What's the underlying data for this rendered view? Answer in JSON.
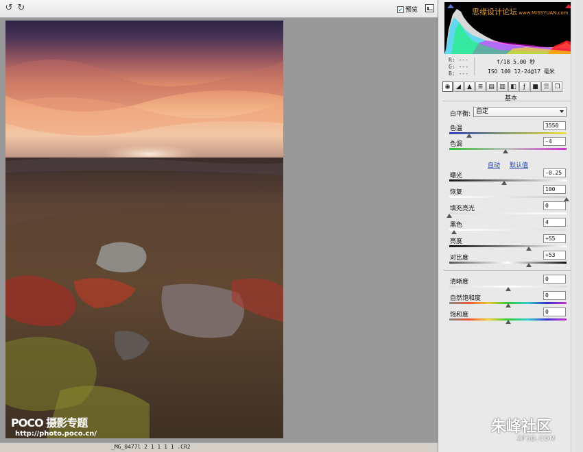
{
  "toolbar": {
    "preview_label": "预览",
    "preview_checked": "✓"
  },
  "status": {
    "file_name": "_MG_0477l 2 1 1 1 1 .CR2"
  },
  "watermarks": {
    "left_brand": "POCO",
    "left_brand_sub": " 摄影专题",
    "left_url": "http://photo.poco.cn/",
    "site_name": "思缘设计论坛",
    "site_url": " www.MISSYUAN.com",
    "right_brand": "朱峰社区",
    "right_url": "ZF3D.COM"
  },
  "readout": {
    "r": "R:  ---",
    "g": "G:  ---",
    "b": "B:  ---",
    "exif_line1": "f/18  5.00 秒",
    "exif_line2": "ISO 100  12-24@17 毫米"
  },
  "panel": {
    "title": "基本",
    "white_balance_label": "白平衡:",
    "white_balance_value": "自定",
    "auto_label": "自动",
    "default_label": "默认值"
  },
  "sliders": {
    "temperature": {
      "label": "色温",
      "value": "3550",
      "position": 0.17
    },
    "tint": {
      "label": "色调",
      "value": "-4",
      "position": 0.48
    },
    "exposure": {
      "label": "曝光",
      "value": "-0.25",
      "position": 0.47
    },
    "recovery": {
      "label": "恢复",
      "value": "100",
      "position": 1.0
    },
    "fill_light": {
      "label": "填充亮光",
      "value": "0",
      "position": 0.0
    },
    "blacks": {
      "label": "黑色",
      "value": "4",
      "position": 0.04
    },
    "brightness": {
      "label": "亮度",
      "value": "+55",
      "position": 0.68
    },
    "contrast": {
      "label": "对比度",
      "value": "+53",
      "position": 0.68
    },
    "clarity": {
      "label": "清晰度",
      "value": "0",
      "position": 0.5
    },
    "vibrance": {
      "label": "自然饱和度",
      "value": "0",
      "position": 0.5
    },
    "saturation": {
      "label": "饱和度",
      "value": "0",
      "position": 0.5
    }
  },
  "tabs": [
    "basic-tab-icon",
    "tone-curve-tab-icon",
    "detail-tab-icon",
    "hsl-tab-icon",
    "split-toning-tab-icon",
    "lens-tab-icon",
    "camera-calibration-tab-icon",
    "fx-tab-icon",
    "camera-profile-tab-icon",
    "presets-tab-icon",
    "snapshots-tab-icon"
  ],
  "colors": {
    "link": "#1f3ea6",
    "site_watermark": "#e39a33",
    "preview_bg": "#999999"
  }
}
